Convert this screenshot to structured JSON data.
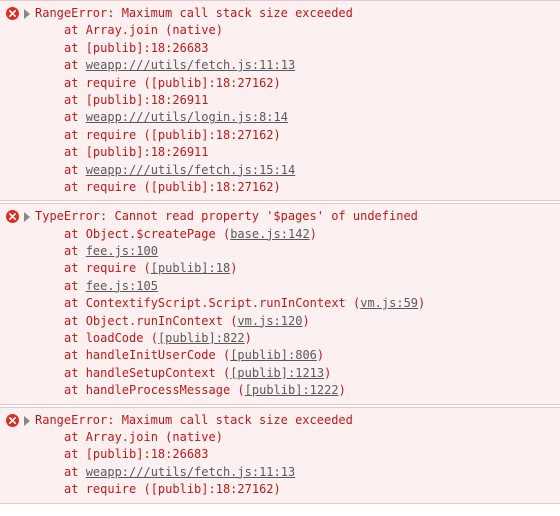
{
  "errors": [
    {
      "message": "RangeError: Maximum call stack size exceeded",
      "stack": [
        {
          "prefix": "at ",
          "text": "Array.join (native)",
          "underline": false
        },
        {
          "prefix": "at ",
          "text": "[publib]:18:26683",
          "underline": false
        },
        {
          "prefix": "at ",
          "text": "weapp:///utils/fetch.js:11:13",
          "underline": true
        },
        {
          "prefix": "at ",
          "text": "require ([publib]:18:27162)",
          "underline": false
        },
        {
          "prefix": "at ",
          "text": "[publib]:18:26911",
          "underline": false
        },
        {
          "prefix": "at ",
          "text": "weapp:///utils/login.js:8:14",
          "underline": true
        },
        {
          "prefix": "at ",
          "text": "require ([publib]:18:27162)",
          "underline": false
        },
        {
          "prefix": "at ",
          "text": "[publib]:18:26911",
          "underline": false
        },
        {
          "prefix": "at ",
          "text": "weapp:///utils/fetch.js:15:14",
          "underline": true
        },
        {
          "prefix": "at ",
          "text": "require ([publib]:18:27162)",
          "underline": false
        }
      ]
    },
    {
      "message": "TypeError: Cannot read property '$pages' of undefined",
      "stack": [
        {
          "prefix": "at ",
          "func": "Object.$createPage",
          "loc": "base.js:142",
          "underline_loc": true
        },
        {
          "prefix": "at ",
          "text": "fee.js:100",
          "underline": true
        },
        {
          "prefix": "at ",
          "func": "require",
          "loc": "[publib]:18",
          "underline_loc": true
        },
        {
          "prefix": "at ",
          "text": "fee.js:105",
          "underline": true
        },
        {
          "prefix": "at ",
          "func": "ContextifyScript.Script.runInContext",
          "loc": "vm.js:59",
          "underline_loc": true
        },
        {
          "prefix": "at ",
          "func": "Object.runInContext",
          "loc": "vm.js:120",
          "underline_loc": true
        },
        {
          "prefix": "at ",
          "func": "loadCode",
          "loc": "[publib]:822",
          "underline_loc": true
        },
        {
          "prefix": "at ",
          "func": "handleInitUserCode",
          "loc": "[publib]:806",
          "underline_loc": true
        },
        {
          "prefix": "at ",
          "func": "handleSetupContext",
          "loc": "[publib]:1213",
          "underline_loc": true
        },
        {
          "prefix": "at ",
          "func": "handleProcessMessage",
          "loc": "[publib]:1222",
          "underline_loc": true
        }
      ]
    },
    {
      "message": "RangeError: Maximum call stack size exceeded",
      "stack": [
        {
          "prefix": "at ",
          "text": "Array.join (native)",
          "underline": false
        },
        {
          "prefix": "at ",
          "text": "[publib]:18:26683",
          "underline": false
        },
        {
          "prefix": "at ",
          "text": "weapp:///utils/fetch.js:11:13",
          "underline": true
        },
        {
          "prefix": "at ",
          "text": "require ([publib]:18:27162)",
          "underline": false
        }
      ]
    }
  ]
}
